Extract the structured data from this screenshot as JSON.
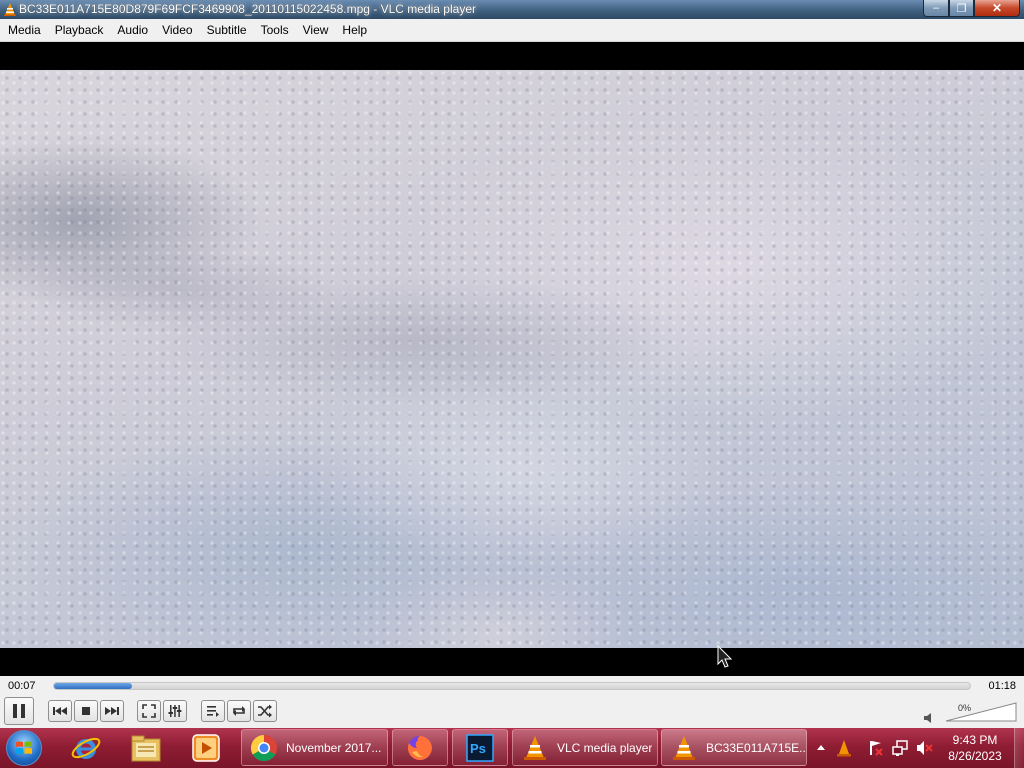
{
  "window": {
    "title": "BC33E011A715E80D879F69FCF3469908_20110115022458.mpg - VLC media player",
    "controls": {
      "minimize": "–",
      "maximize": "❐",
      "close": "✕"
    }
  },
  "menu": [
    "Media",
    "Playback",
    "Audio",
    "Video",
    "Subtitle",
    "Tools",
    "View",
    "Help"
  ],
  "player": {
    "elapsed": "00:07",
    "total": "01:18",
    "progress": 0.085,
    "volume_label": "0%",
    "volume": 0,
    "buttons": [
      "pause-icon",
      "previous-icon",
      "stop-icon",
      "next-icon",
      "fullscreen-icon",
      "extended-settings-icon",
      "playlist-icon",
      "loop-icon",
      "shuffle-icon"
    ]
  },
  "taskbar": {
    "pinned": [
      "windows-start-orb",
      "internet-explorer-icon",
      "file-explorer-icon",
      "media-player-icon"
    ],
    "tasks": [
      {
        "label": "November 2017...",
        "icon": "chrome-icon"
      },
      {
        "label": "",
        "icon": "firefox-icon"
      },
      {
        "label": "",
        "icon": "photoshop-icon"
      },
      {
        "label": "VLC media player",
        "icon": "vlc-icon"
      },
      {
        "label": "BC33E011A715E...",
        "icon": "vlc-icon"
      }
    ],
    "clock": {
      "time": "9:43 PM",
      "date": "8/26/2023"
    },
    "photoshop_text": "Ps"
  },
  "colors": {
    "accent": "#2f6fc3",
    "taskbar": "#8f1d33",
    "vlc_orange": "#f29400"
  }
}
